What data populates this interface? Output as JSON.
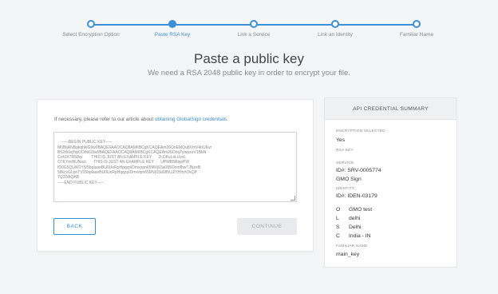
{
  "stepper": {
    "steps": [
      {
        "label": "Select Encryption Option"
      },
      {
        "label": "Paste RSA Key"
      },
      {
        "label": "Link a Service"
      },
      {
        "label": "Link an Identity"
      },
      {
        "label": "Familiar Name"
      }
    ],
    "active_step": "Paste RSA Key"
  },
  "header": {
    "title": "Paste a public key",
    "subtitle": "We need a RSA 2048 public key in order to encrypt your file."
  },
  "form": {
    "note_prefix": "If necessary, please refer to our article about ",
    "note_link": "obtaining GlobalSign credentials",
    "note_suffix": ".",
    "key_text": "-----BEGIN PUBLIC KEY-----\nMIIBIjANBgkqhkiG9w0BAQEFAAOCAQ8AMIIBCgKCAQEAm26OnEMQu8VmV4nUKvr\nB52rb6qYqtOOhbG9w0BAQEFAAOCAQ8AMIIBCgKCAQEAm26OnqTyinpzoV1BbN\nCv4JX7R9Jky        THIS IS JUST AN EXAMPLE KEY      2t.DKuLsLUvvL\nO7KYmHiUNszi       THIS IS JUST AN EXAMPLE KEY      UPWB5RqwPW\nfD0G5QLWOYjV5bplaanBU0UeRpHqqzpIDmxopn65MVj03a085OomfbwTJNzeB\n58kcvGLpnTV05bplaanBU0UeRpHqqzpIDmxopn65MVj03a085UJIYHhvrOkQP\n7Q3DAQAB\n-----END PUBLIC KEY-----",
    "back_label": "BACK",
    "continue_label": "CONTINUE"
  },
  "summary": {
    "title": "API CREDENTIAL SUMMARY",
    "encryption_label": "ENCRYPTION SELECTED",
    "encryption_value": "Yes",
    "rsa_label": "RSA KEY",
    "service_label": "SERVICE",
    "service_id": "ID#: SRV-0005774",
    "service_name": "GMO Sign",
    "identity_label": "IDENTITY",
    "identity_id": "ID#:  IDEN-03179",
    "identity_fields": [
      {
        "k": "O",
        "v": "GMO test"
      },
      {
        "k": "L",
        "v": "delhi"
      },
      {
        "k": "S",
        "v": "Delhi"
      },
      {
        "k": "C",
        "v": "India - IN"
      }
    ],
    "familiar_label": "FAMILIAR NAME",
    "familiar_value": "main_key"
  },
  "colors": {
    "accent": "#3a8fd6",
    "background": "#f4f5f7",
    "disabled_button": "#e9eaec"
  }
}
